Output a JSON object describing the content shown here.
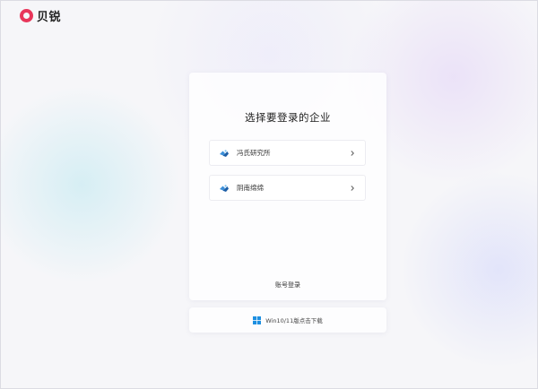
{
  "brand": {
    "name": "贝锐",
    "logo_color": "#e8365a"
  },
  "card": {
    "title": "选择要登录的企业",
    "companies": [
      {
        "name": "冯氏研究所",
        "icon": "cloud-icon"
      },
      {
        "name": "阴南绵绵",
        "icon": "cloud-icon"
      }
    ],
    "account_login_label": "账号登录"
  },
  "download": {
    "label": "Win10/11版点击下载",
    "icon": "windows-icon",
    "icon_color": "#1d8fe1"
  }
}
